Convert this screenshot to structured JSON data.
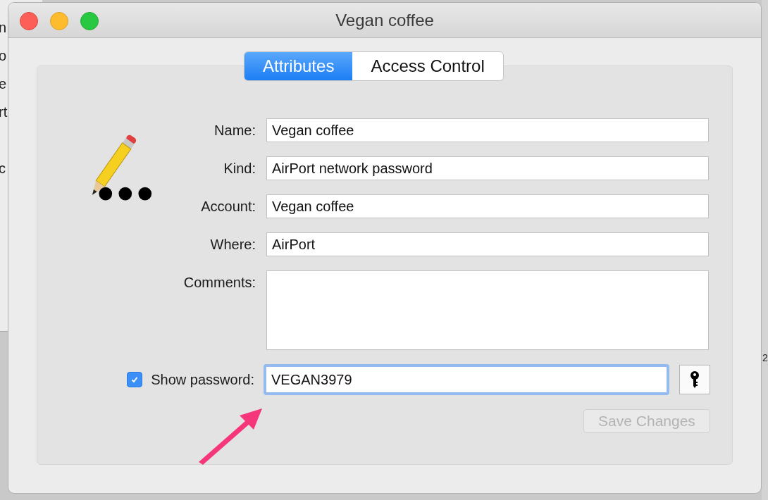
{
  "background_window": {
    "fragments": [
      "n",
      "o",
      "e",
      "rt",
      "c"
    ],
    "right_fragment": "2"
  },
  "window": {
    "title": "Vegan coffee"
  },
  "tabs": [
    {
      "label": "Attributes",
      "selected": true
    },
    {
      "label": "Access Control",
      "selected": false
    }
  ],
  "fields": [
    {
      "label": "Name:",
      "value": "Vegan coffee"
    },
    {
      "label": "Kind:",
      "value": "AirPort network password"
    },
    {
      "label": "Account:",
      "value": "Vegan coffee"
    },
    {
      "label": "Where:",
      "value": "AirPort"
    }
  ],
  "comments": {
    "label": "Comments:"
  },
  "show_password": {
    "label": "Show password:",
    "checked": true,
    "value": "VEGAN3979"
  },
  "save_button": {
    "label": "Save Changes",
    "disabled": true
  }
}
